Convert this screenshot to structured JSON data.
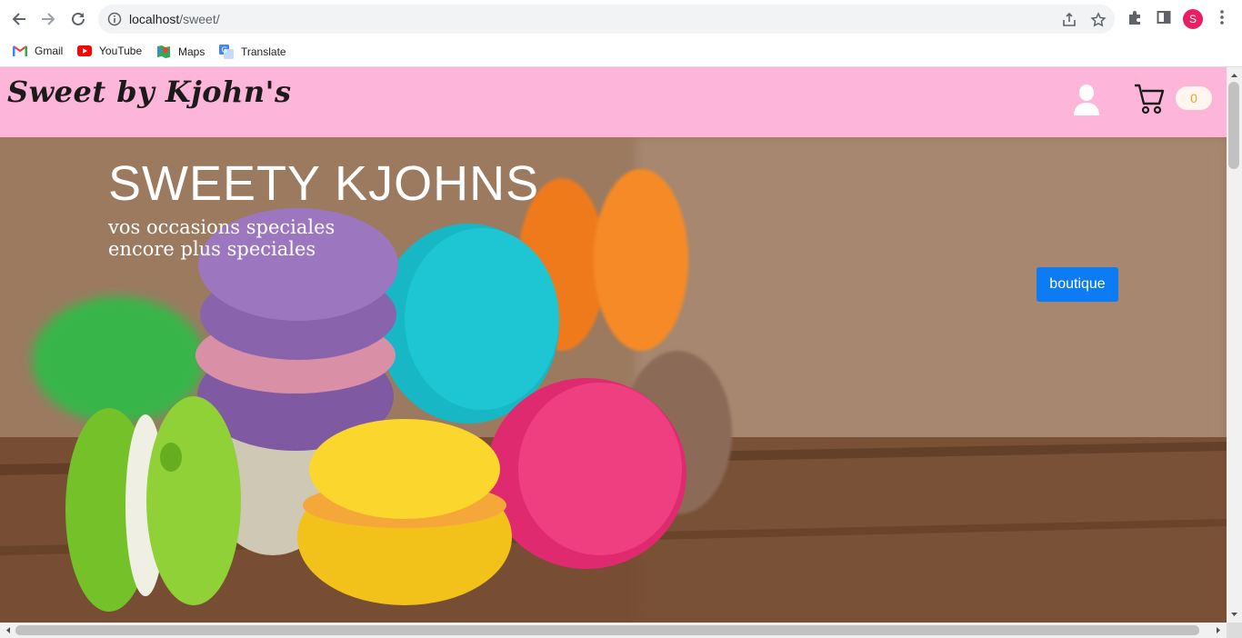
{
  "browser": {
    "url_host": "localhost",
    "url_path": "/sweet/",
    "avatar_letter": "S",
    "bookmarks": [
      {
        "label": "Gmail",
        "icon": "gmail-icon"
      },
      {
        "label": "YouTube",
        "icon": "youtube-icon"
      },
      {
        "label": "Maps",
        "icon": "maps-icon"
      },
      {
        "label": "Translate",
        "icon": "translate-icon"
      }
    ]
  },
  "site": {
    "logo": "Sweet by Kjohn's",
    "cart_count": "0",
    "hero": {
      "title": "SWEETY KJOHNS",
      "subtitle_line1": "vos occasions speciales",
      "subtitle_line2": "encore plus speciales",
      "button_label": "boutique"
    }
  },
  "colors": {
    "header_bg": "#fdb6da",
    "button_bg": "#0d7bf3",
    "cart_count_color": "#f0a020"
  }
}
